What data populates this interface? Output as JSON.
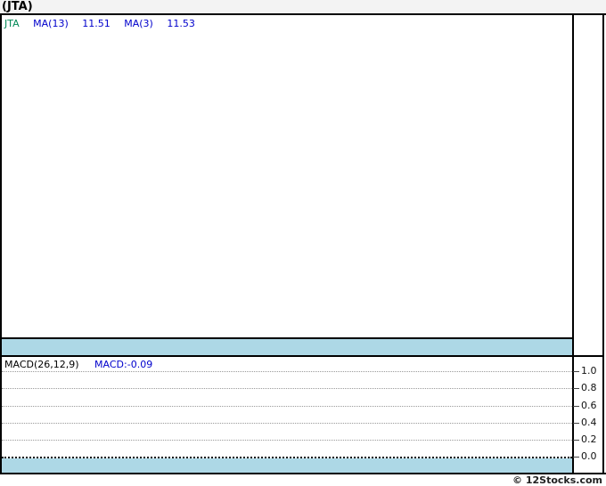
{
  "title": "(JTA)",
  "main_chart": {
    "legend": {
      "symbol": "JTA",
      "ma13_label": "MA(13)",
      "ma13_value": "11.51",
      "ma3_label": "MA(3)",
      "ma3_value": "11.53"
    }
  },
  "macd_chart": {
    "legend_label": "MACD(26,12,9)",
    "legend_value": "MACD:-0.09",
    "axis_labels": [
      "1.0",
      "0.8",
      "0.6",
      "0.4",
      "0.2",
      "0.0"
    ]
  },
  "footer": {
    "copyright": "© 12Stocks.com"
  },
  "colors": {
    "accent_blue": "#0000cc",
    "symbol_green": "#008855",
    "band_blue": "#add8e6",
    "grid_gray": "#9a9a9a",
    "titlebar_gray": "#f3f3f3"
  },
  "chart_data": [
    {
      "type": "line",
      "title": "(JTA) price panel",
      "series": [
        {
          "name": "JTA",
          "values": []
        },
        {
          "name": "MA(13)",
          "last_value": 11.51,
          "values": []
        },
        {
          "name": "MA(3)",
          "last_value": 11.53,
          "values": []
        }
      ],
      "grid": false,
      "note_visible_content": "plot area is empty in screenshot"
    },
    {
      "type": "line",
      "title": "MACD(26,12,9)",
      "last_value": -0.09,
      "yticks": [
        1.0,
        0.8,
        0.6,
        0.4,
        0.2,
        0.0
      ],
      "ylim": [
        0.0,
        1.0
      ],
      "grid": true,
      "legend_position": "top-left",
      "values": []
    }
  ]
}
